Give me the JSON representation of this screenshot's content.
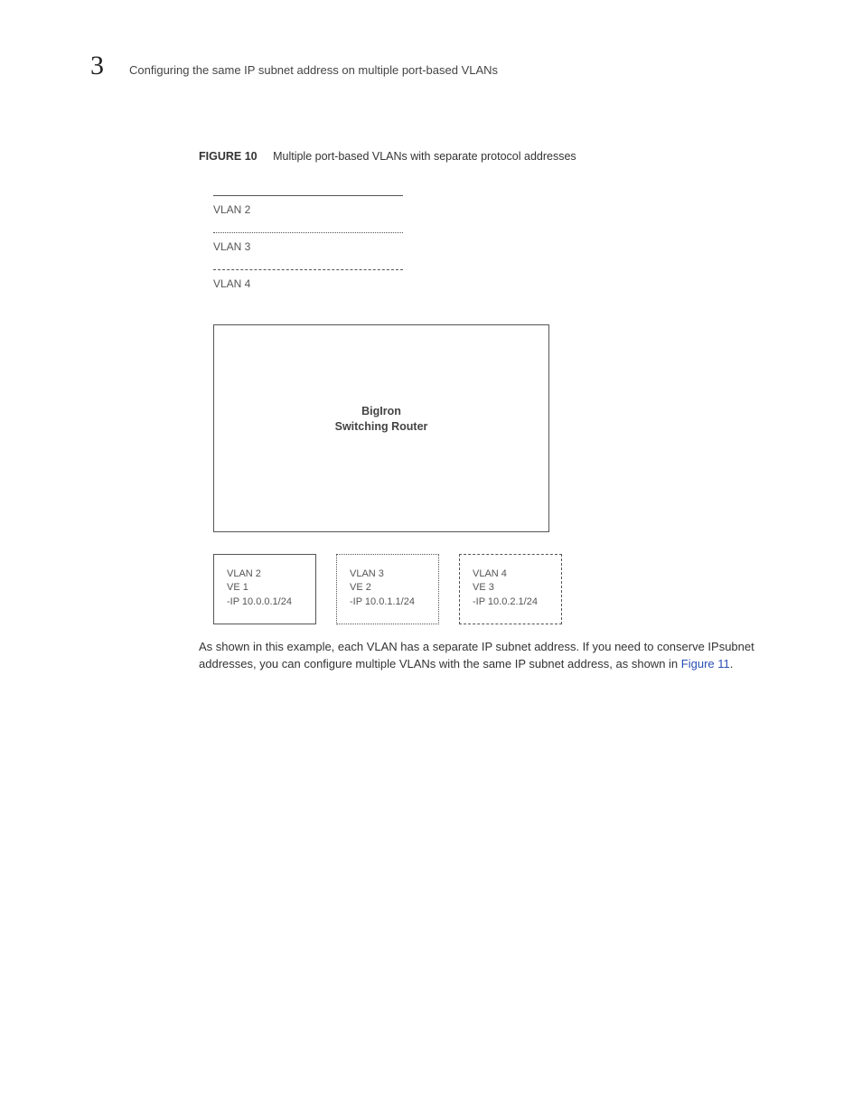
{
  "chapter": "3",
  "header": "Configuring the same IP subnet address on multiple port-based VLANs",
  "figure": {
    "label": "FIGURE 10",
    "caption": "Multiple port-based VLANs with separate protocol addresses"
  },
  "legend": {
    "vlan2": "VLAN 2",
    "vlan3": "VLAN 3",
    "vlan4": "VLAN 4"
  },
  "router": {
    "line1": "BigIron",
    "line2": "Switching Router"
  },
  "vlans": [
    {
      "name": "VLAN 2",
      "ve": "VE 1",
      "ip": "-IP 10.0.0.1/24"
    },
    {
      "name": "VLAN 3",
      "ve": "VE 2",
      "ip": "-IP 10.0.1.1/24"
    },
    {
      "name": "VLAN 4",
      "ve": "VE 3",
      "ip": "-IP 10.0.2.1/24"
    }
  ],
  "paragraph": {
    "pre": "As shown in this example, each VLAN has a separate IP subnet address. If you need to conserve IPsubnet addresses, you can configure multiple VLANs with the same IP subnet address, as shown in ",
    "link": "Figure 11",
    "post": "."
  }
}
